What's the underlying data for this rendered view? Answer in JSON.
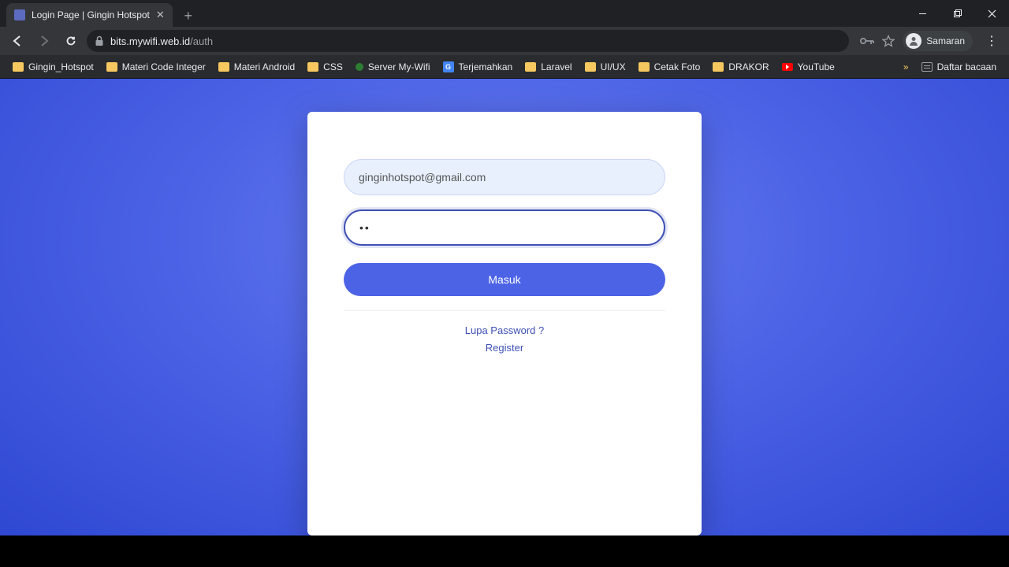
{
  "browser": {
    "tab_title": "Login Page | Gingin Hotspot",
    "url_host": "bits.mywifi.web.id",
    "url_path": "/auth",
    "profile_name": "Samaran",
    "reading_list": "Daftar bacaan",
    "bookmarks": [
      {
        "label": "Gingin_Hotspot",
        "icon": "folder"
      },
      {
        "label": "Materi Code Integer",
        "icon": "folder"
      },
      {
        "label": "Materi Android",
        "icon": "folder"
      },
      {
        "label": "CSS",
        "icon": "folder"
      },
      {
        "label": "Server My-Wifi",
        "icon": "dot-green"
      },
      {
        "label": "Terjemahkan",
        "icon": "gt"
      },
      {
        "label": "Laravel",
        "icon": "folder"
      },
      {
        "label": "UI/UX",
        "icon": "folder"
      },
      {
        "label": "Cetak Foto",
        "icon": "folder"
      },
      {
        "label": "DRAKOR",
        "icon": "folder"
      },
      {
        "label": "YouTube",
        "icon": "yt"
      }
    ]
  },
  "login": {
    "email_value": "ginginhotspot@gmail.com",
    "password_value": "••",
    "submit_label": "Masuk",
    "forgot_label": "Lupa Password ?",
    "register_label": "Register"
  }
}
